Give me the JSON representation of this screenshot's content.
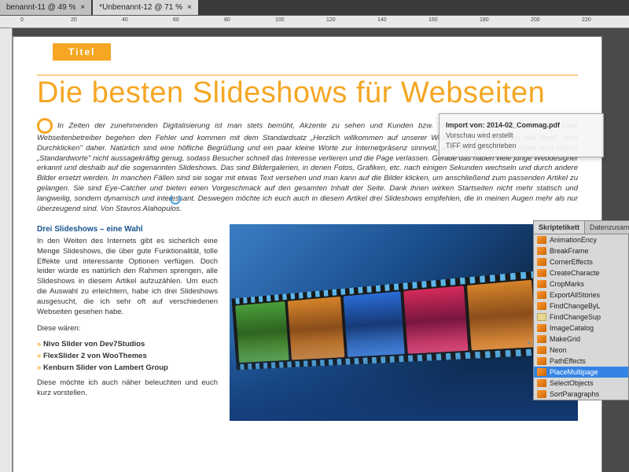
{
  "tabs": [
    {
      "label": "benannt-11 @ 49 %",
      "active": false
    },
    {
      "label": "*Unbenannt-12 @ 71 %",
      "active": true
    }
  ],
  "ruler_marks": [
    "0",
    "20",
    "40",
    "60",
    "80",
    "100",
    "120",
    "140",
    "160",
    "180",
    "200",
    "220"
  ],
  "document": {
    "title_chip": "Titel",
    "headline": "Die besten Slideshows für Webseiten",
    "lead_paragraph": "In Zeiten der zunehmenden Digitalisierung ist man stets bemüht, Akzente zu sehen und Kunden bzw. User auf seine Seite zu locken. Viele Webseitenbetreiber begehen den Fehler und kommen mit dem Standardsatz „Herzlich willkommen auf unserer Webseite (…), haben Sie viel Spaß beim Durchklicken\" daher. Natürlich sind eine höfliche Begrüßung und ein paar kleine Worte zur Internetpräsenz sinnvoll, aber auf der anderen Seite sind solche „Standardworte\" nicht aussagekräftig genug, sodass Besucher schnell das Interesse verlieren und die Page verlassen. Gerade das haben viele junge Webdesigner erkannt und deshalb auf die sogenannten Slideshows. Das sind Bildergalerien, in denen Fotos, Grafiken, etc. nach einigen Sekunden wechseln und durch andere Bilder ersetzt werden. In manchen Fällen sind sie sogar mit etwas Text versehen und man kann auf die Bilder klicken, um anschließend zum passenden Artikel zu gelangen. Sie sind Eye-Catcher und bieten einen Vorgeschmack auf den gesamten Inhalt der Seite. Dank ihnen wirken Startseiten nicht mehr statisch und langweilig, sondern dynamisch und interessant. Deswegen möchte ich euch auch in diesem Artikel drei Slideshows empfehlen, die in meinen Augen mehr als nur überzeugend sind. Von Stavros Alahopulos.",
    "subhead": "Drei Slideshows – eine Wahl",
    "col_p1": "In den Weiten des Internets gibt es sicherlich eine Menge Slideshows, die über gute Funktionalität, tolle Effekte und interessante Optionen verfügen. Doch leider würde es natürlich den Rahmen sprengen, alle Slideshows in diesem Artikel aufzuzählen. Um euch die Auswahl zu erleichtern, habe ich drei Slideshows ausgesucht, die ich sehr oft auf verschiedenen Webseiten gesehen habe.",
    "col_p2": "Diese wären:",
    "bullets": [
      "Nivo Slider von Dev7Studios",
      "FlexSlider 2 von WooThemes",
      "Kenburn Slider von Lambert Group"
    ],
    "col_p3": "Diese möchte ich auch näher beleuchten und euch kurz vorstellen."
  },
  "tooltip": {
    "line1_label": "Import von:",
    "line1_value": "2014-02_Commag.pdf",
    "line2": "Vorschau wird erstellt",
    "line3": "TIFF wird geschrieben"
  },
  "panel": {
    "tabs": [
      "Skriptetikett",
      "Datenzusamm"
    ],
    "scripts": [
      {
        "name": "AnimationEncy",
        "type": "script"
      },
      {
        "name": "BreakFrame",
        "type": "script"
      },
      {
        "name": "CornerEffects",
        "type": "script"
      },
      {
        "name": "CreateCharacte",
        "type": "script"
      },
      {
        "name": "CropMarks",
        "type": "script"
      },
      {
        "name": "ExportAllStories",
        "type": "script"
      },
      {
        "name": "FindChangeByL",
        "type": "script"
      },
      {
        "name": "FindChangeSup",
        "type": "folder"
      },
      {
        "name": "ImageCatalog",
        "type": "script"
      },
      {
        "name": "MakeGrid",
        "type": "script"
      },
      {
        "name": "Neon",
        "type": "script"
      },
      {
        "name": "PathEffects",
        "type": "script"
      },
      {
        "name": "PlaceMultipage",
        "type": "script",
        "selected": true
      },
      {
        "name": "SelectObjects",
        "type": "script"
      },
      {
        "name": "SortParagraphs",
        "type": "script"
      }
    ]
  }
}
